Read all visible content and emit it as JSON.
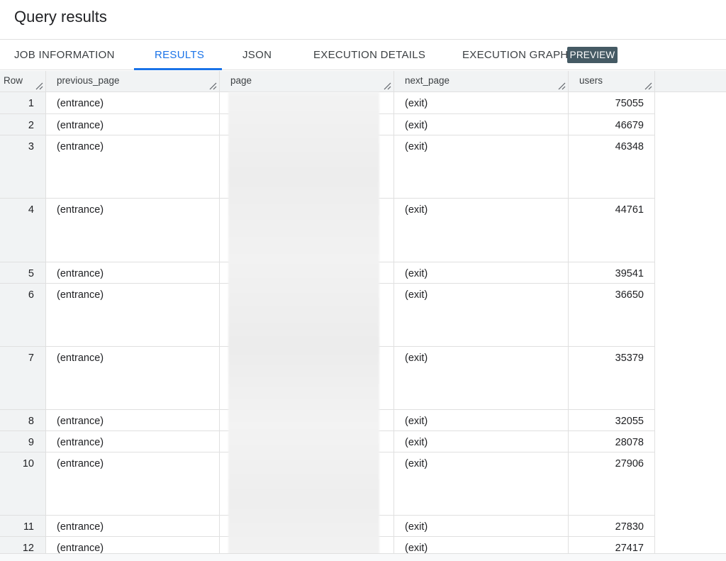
{
  "header": {
    "title": "Query results"
  },
  "tabs": [
    {
      "label": "JOB INFORMATION",
      "active": false
    },
    {
      "label": "RESULTS",
      "active": true
    },
    {
      "label": "JSON",
      "active": false
    },
    {
      "label": "EXECUTION DETAILS",
      "active": false
    },
    {
      "label": "EXECUTION GRAPH",
      "active": false,
      "badge": "PREVIEW"
    }
  ],
  "colors": {
    "accent": "#1a73e8",
    "badge_bg": "#455a64"
  },
  "table": {
    "columns": [
      "Row",
      "previous_page",
      "page",
      "next_page",
      "users"
    ],
    "rows": [
      {
        "row": "1",
        "previous_page": "(entrance)",
        "page": "",
        "next_page": "(exit)",
        "users": "75055"
      },
      {
        "row": "2",
        "previous_page": "(entrance)",
        "page": "",
        "next_page": "(exit)",
        "users": "46679"
      },
      {
        "row": "3",
        "previous_page": "(entrance)",
        "page": "",
        "next_page": "(exit)",
        "users": "46348"
      },
      {
        "row": "4",
        "previous_page": "(entrance)",
        "page": "",
        "next_page": "(exit)",
        "users": "44761"
      },
      {
        "row": "5",
        "previous_page": "(entrance)",
        "page": "",
        "next_page": "(exit)",
        "users": "39541"
      },
      {
        "row": "6",
        "previous_page": "(entrance)",
        "page": "",
        "next_page": "(exit)",
        "users": "36650"
      },
      {
        "row": "7",
        "previous_page": "(entrance)",
        "page": "",
        "next_page": "(exit)",
        "users": "35379"
      },
      {
        "row": "8",
        "previous_page": "(entrance)",
        "page": "",
        "next_page": "(exit)",
        "users": "32055"
      },
      {
        "row": "9",
        "previous_page": "(entrance)",
        "page": "",
        "next_page": "(exit)",
        "users": "28078"
      },
      {
        "row": "10",
        "previous_page": "(entrance)",
        "page": "",
        "next_page": "(exit)",
        "users": "27906"
      },
      {
        "row": "11",
        "previous_page": "(entrance)",
        "page": "",
        "next_page": "(exit)",
        "users": "27830"
      },
      {
        "row": "12",
        "previous_page": "(entrance)",
        "page": "",
        "next_page": "(exit)",
        "users": "27417"
      }
    ]
  }
}
